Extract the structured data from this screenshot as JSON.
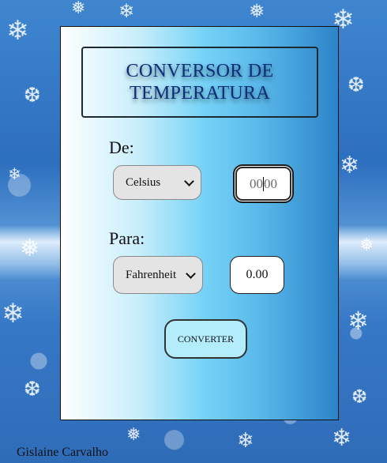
{
  "converter": {
    "title_line1": "CONVERSOR DE",
    "title_line2": "TEMPERATURA",
    "from_label": "De:",
    "from_unit": "Celsius",
    "from_value_left": "00",
    "from_value_right": "00",
    "to_label": "Para:",
    "to_unit": "Fahrenheit",
    "to_value": "0.00",
    "convert_button": "CONVERTER"
  },
  "footer": {
    "author": "Gislaine Carvalho"
  },
  "colors": {
    "title": "#0c2d7a",
    "button_bg": "#b3ecfb",
    "background": "#3f86cf"
  }
}
